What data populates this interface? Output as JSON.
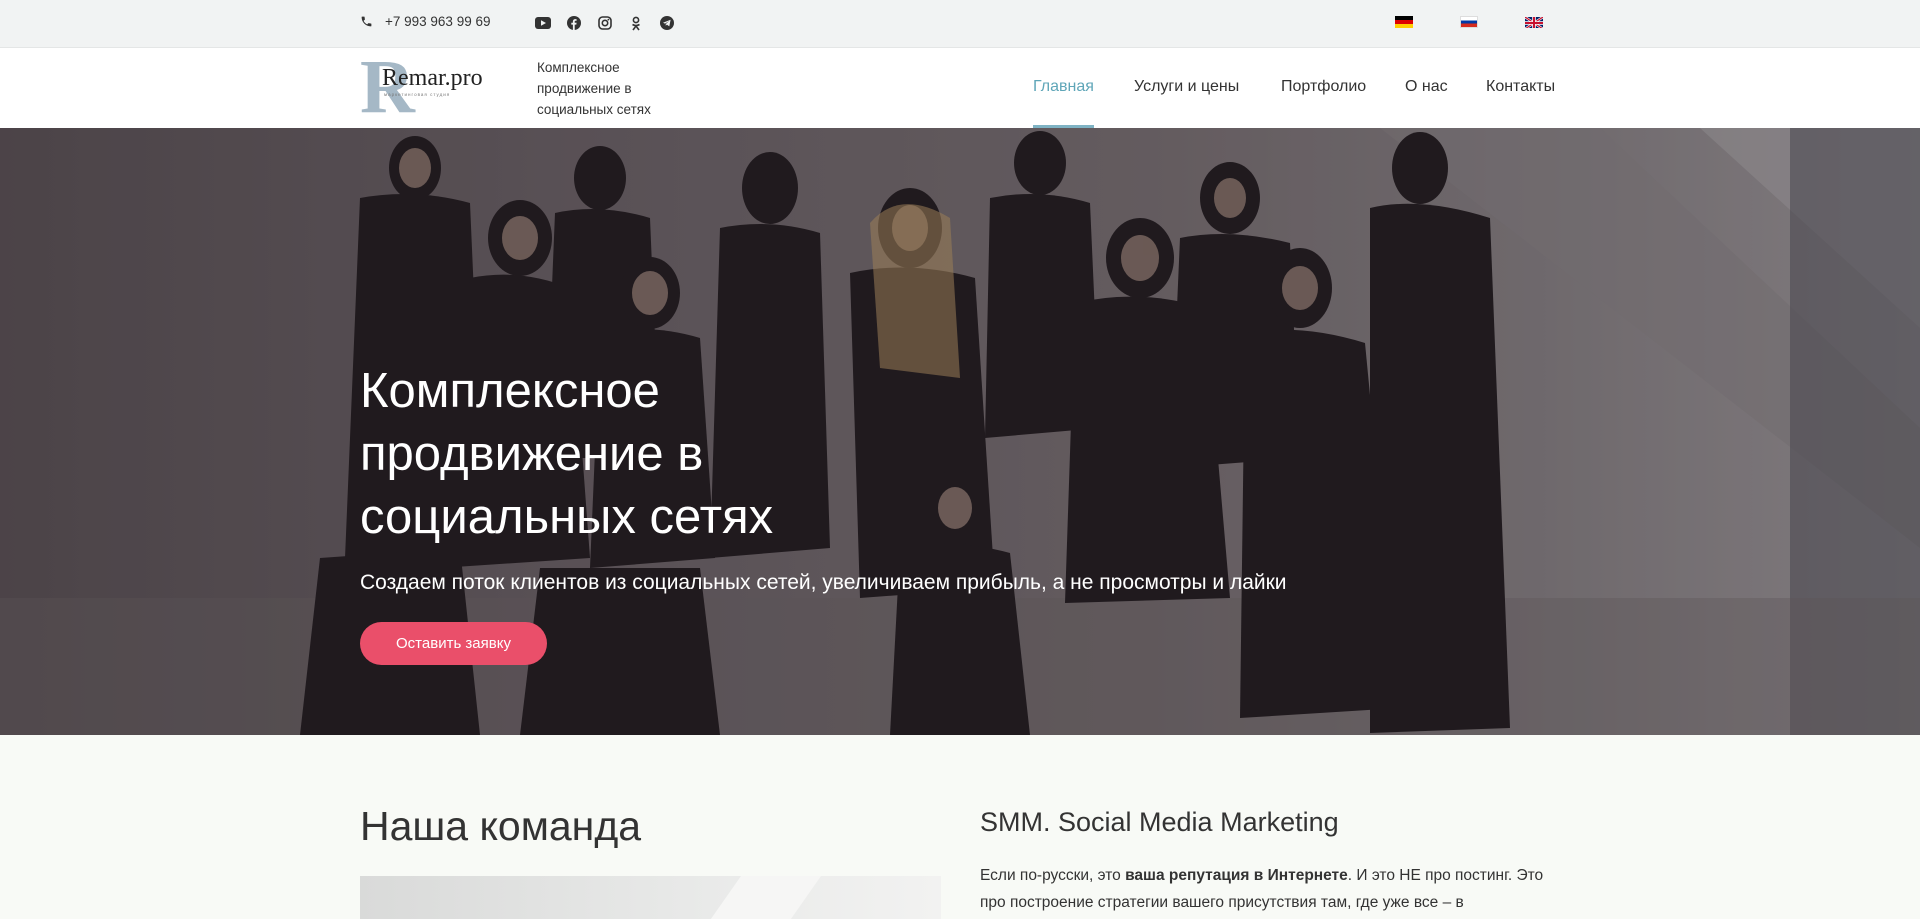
{
  "topbar": {
    "phone": "+7 993 963 99 69",
    "socials": [
      "youtube-icon",
      "facebook-icon",
      "instagram-icon",
      "odnoklassniki-icon",
      "telegram-icon"
    ],
    "languages": [
      "de",
      "ru",
      "en"
    ]
  },
  "header": {
    "logo_text": "Remar.pro",
    "logo_letter": "R",
    "logo_caption": "маркетинговая студия",
    "tagline": "Комплексное продвижение в социальных сетях",
    "nav": [
      {
        "label": "Главная",
        "active": true
      },
      {
        "label": "Услуги и цены",
        "active": false
      },
      {
        "label": "Портфолио",
        "active": false
      },
      {
        "label": "О нас",
        "active": false
      },
      {
        "label": "Контакты",
        "active": false
      }
    ]
  },
  "hero": {
    "title": "Комплексное продвижение в социальных сетях",
    "subtitle": "Создаем поток клиентов из социальных сетей, увеличиваем прибыль, а не просмотры и лайки",
    "cta": "Оставить заявку"
  },
  "team": {
    "title": "Наша команда"
  },
  "smm": {
    "title": "SMM. Social Media Marketing",
    "text_before": "Если по-русски, это ",
    "text_bold": "ваша репутация в Интернете",
    "text_after": ". И это НЕ про постинг. Это про построение стратегии вашего присутствия там, где уже все – в"
  },
  "colors": {
    "accent_nav": "#5fa6b8",
    "cta": "#ea4f6a",
    "topbar_bg": "#f1f3f3",
    "page_bg": "#f8faf6"
  }
}
